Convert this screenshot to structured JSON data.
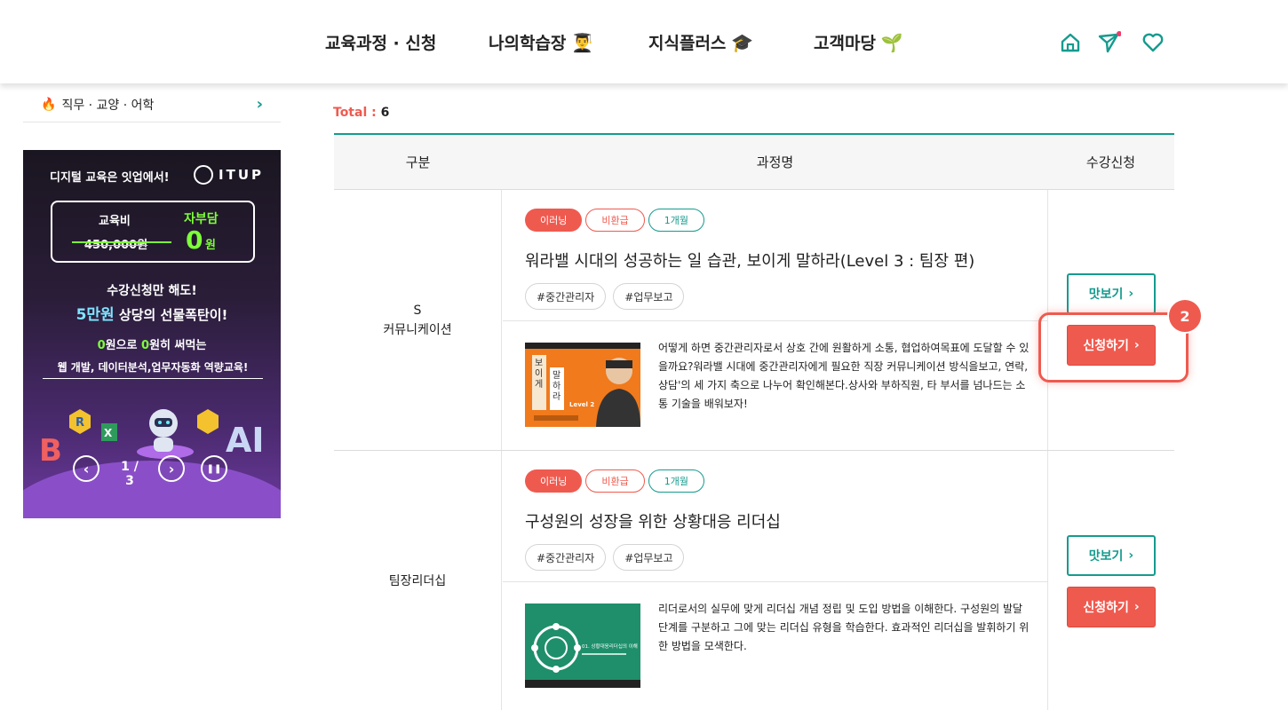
{
  "nav": {
    "items": [
      {
        "label": "교육과정 · 신청",
        "emoji": ""
      },
      {
        "label": "나의학습장",
        "emoji": "👨‍🎓"
      },
      {
        "label": "지식플러스",
        "emoji": "🎓"
      },
      {
        "label": "고객마당",
        "emoji": "🌱"
      }
    ],
    "icons": [
      "home-icon",
      "send-icon",
      "heart-icon"
    ]
  },
  "sidebar": {
    "category": {
      "emoji": "🔥",
      "label": "직무 · 교양 · 어학",
      "chevron": "›"
    },
    "banner": {
      "slogan": "디지털 교육은 잇업에서!",
      "logo": "ITUP",
      "fee_label": "교육비",
      "self_pay_label": "자부담",
      "old_price": "450,000원",
      "zero": "0",
      "won": "원",
      "line1": "수강신청만 해도!",
      "line2_hl": "5만원",
      "line2_rest": " 상당의 선물폭탄이!",
      "line3_zero1": "0",
      "line3_mid": "원으로 ",
      "line3_zero2": "0",
      "line3_rest": "원히 써먹는",
      "line4": "웹 개발, 데이터분석,업무자동화 역량교육!",
      "counter": "1 / 3",
      "prev": "‹",
      "next": "›",
      "pause": "❚❚"
    }
  },
  "main": {
    "total_label": "Total : ",
    "total_value": "6",
    "headers": {
      "category": "구분",
      "title": "과정명",
      "apply": "수강신청"
    },
    "courses": [
      {
        "category_lines": [
          "S",
          "커뮤니케이션"
        ],
        "badges": [
          "이러닝",
          "비환급",
          "1개월"
        ],
        "title": "워라밸 시대의 성공하는 일 습관, 보이게 말하라(Level 3 : 팀장 편)",
        "tags": [
          "#중간관리자",
          "#업무보고"
        ],
        "description": "어떻게 하면 중간관리자로서 상호 간에 원활하게 소통, 협업하여목표에 도달할 수 있을까요?워라밸 시대에 중간관리자에게 필요한 직장 커뮤니케이션 방식을보고, 연락, 상담'의 세 가지 축으로 나누어 확인해본다.상사와 부하직원, 타 부서를 넘나드는 소통 기술을 배워보자!",
        "preview_label": "맛보기",
        "apply_label": "신청하기"
      },
      {
        "category_lines": [
          "팀장리더십"
        ],
        "badges": [
          "이러닝",
          "비환급",
          "1개월"
        ],
        "title": "구성원의 성장을 위한 상황대응 리더십",
        "tags": [
          "#중간관리자",
          "#업무보고"
        ],
        "description": "리더로서의 실무에 맞게 리더십 개념 정립 및 도입 방법을 이해한다. 구성원의 발달단계를 구분하고 그에 맞는 리더십 유형을 학습한다. 효과적인 리더십을 발휘하기 위한 방법을 모색한다.",
        "preview_label": "맛보기",
        "apply_label": "신청하기"
      }
    ],
    "step_badge": "2",
    "thumb1": {
      "vertical_text": [
        "보",
        "이",
        "게",
        "말",
        "하",
        "라"
      ],
      "level": "Level 2"
    },
    "thumb2": {
      "caption": "01. 상황대응리더십의 이해"
    }
  },
  "colors": {
    "accent": "#159b8e",
    "primary_red": "#ef5a4f"
  }
}
